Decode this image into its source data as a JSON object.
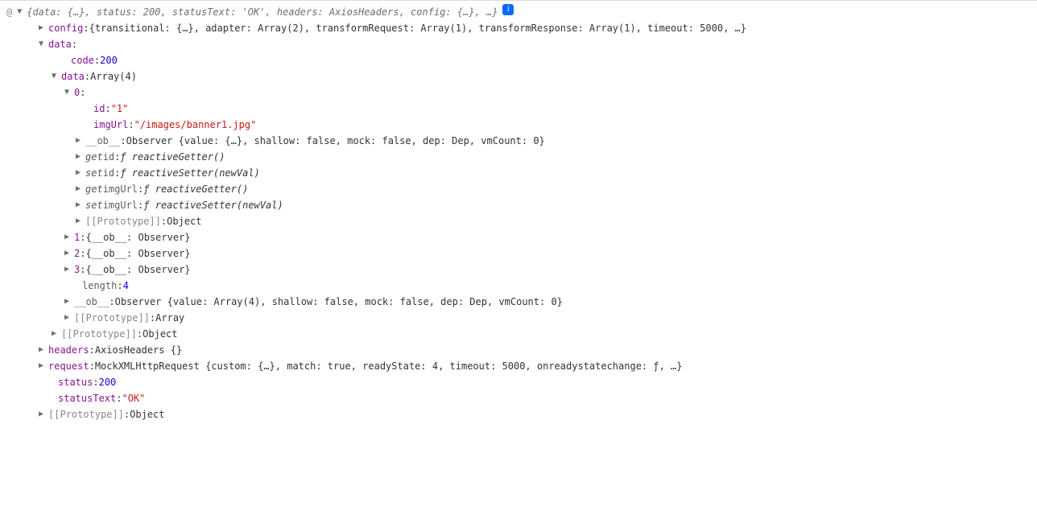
{
  "header": {
    "at_symbol": "@",
    "summary": "{data: {…}, status: 200, statusText: 'OK', headers: AxiosHeaders, config: {…}, …}",
    "info_tooltip": "i"
  },
  "config": {
    "key": "config",
    "summary": "{transitional: {…}, adapter: Array(2), transformRequest: Array(1), transformResponse: Array(1), timeout: 5000, …}"
  },
  "data_section": {
    "key": "data",
    "code_key": "code",
    "code_value": "200",
    "data_key": "data",
    "data_type": "Array(4)",
    "items": [
      {
        "index": "0",
        "id_key": "id",
        "id_value": "\"1\"",
        "imgurl_key": "imgUrl",
        "imgurl_value": "\"/images/banner1.jpg\"",
        "ob_key": "__ob__",
        "ob_summary": "Observer {value: {…}, shallow: false, mock: false, dep: Dep, vmCount: 0}",
        "getters_setters": [
          {
            "kind": "get",
            "prop": "id",
            "fn": "ƒ reactiveGetter()"
          },
          {
            "kind": "set",
            "prop": "id",
            "fn": "ƒ reactiveSetter(newVal)"
          },
          {
            "kind": "get",
            "prop": "imgUrl",
            "fn": "ƒ reactiveGetter()"
          },
          {
            "kind": "set",
            "prop": "imgUrl",
            "fn": "ƒ reactiveSetter(newVal)"
          }
        ],
        "proto_key": "[[Prototype]]",
        "proto_value": "Object"
      }
    ],
    "collapsed_items": [
      {
        "index": "1",
        "summary": "{__ob__: Observer}"
      },
      {
        "index": "2",
        "summary": "{__ob__: Observer}"
      },
      {
        "index": "3",
        "summary": "{__ob__: Observer}"
      }
    ],
    "length_key": "length",
    "length_value": "4",
    "array_ob_key": "__ob__",
    "array_ob_summary": "Observer {value: Array(4), shallow: false, mock: false, dep: Dep, vmCount: 0}",
    "array_proto_key": "[[Prototype]]",
    "array_proto_value": "Array",
    "outer_proto_key": "[[Prototype]]",
    "outer_proto_value": "Object"
  },
  "headers_section": {
    "key": "headers",
    "summary": "AxiosHeaders {}"
  },
  "request_section": {
    "key": "request",
    "summary": "MockXMLHttpRequest {custom: {…}, match: true, readyState: 4, timeout: 5000, onreadystatechange: ƒ, …}"
  },
  "status": {
    "key": "status",
    "value": "200"
  },
  "statusText": {
    "key": "statusText",
    "value": "\"OK\""
  },
  "root_proto": {
    "key": "[[Prototype]]",
    "value": "Object"
  }
}
